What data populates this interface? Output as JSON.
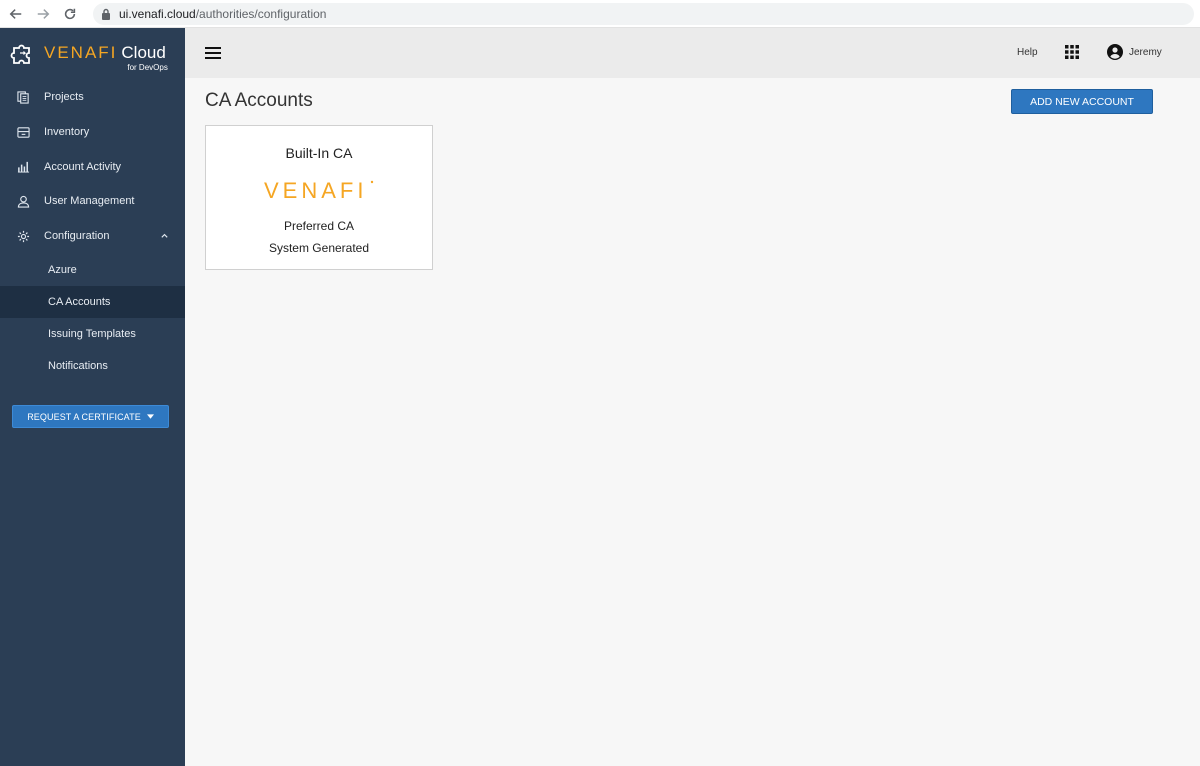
{
  "browser": {
    "url_host": "ui.venafi.cloud",
    "url_path": "/authorities/configuration"
  },
  "brand": {
    "name": "VENAFI",
    "product": "Cloud",
    "subtitle": "for DevOps",
    "accent_color": "#f5a623"
  },
  "sidebar": {
    "items": [
      {
        "label": "Projects",
        "icon": "projects-icon"
      },
      {
        "label": "Inventory",
        "icon": "inventory-icon"
      },
      {
        "label": "Account Activity",
        "icon": "bar-chart-icon"
      },
      {
        "label": "User Management",
        "icon": "user-icon"
      },
      {
        "label": "Configuration",
        "icon": "gear-icon"
      }
    ],
    "subitems": [
      {
        "label": "Azure"
      },
      {
        "label": "CA Accounts",
        "active": true
      },
      {
        "label": "Issuing Templates"
      },
      {
        "label": "Notifications"
      }
    ],
    "request_button": "REQUEST A CERTIFICATE"
  },
  "header": {
    "help": "Help",
    "user": "Jeremy"
  },
  "main": {
    "title": "CA Accounts",
    "add_button": "ADD NEW ACCOUNT",
    "card": {
      "title": "Built-In CA",
      "logo_text": "VENAFI",
      "line1": "Preferred CA",
      "line2": "System Generated"
    }
  },
  "colors": {
    "sidebar_bg": "#2b3e55",
    "sidebar_active": "#1e2f43",
    "primary_button": "#2e77c0",
    "brand_orange": "#f5a623"
  }
}
